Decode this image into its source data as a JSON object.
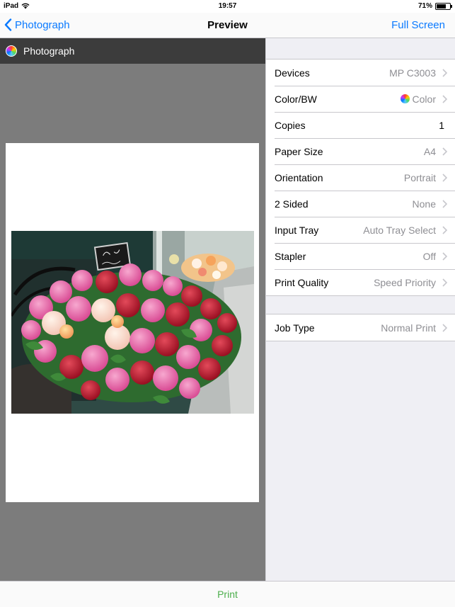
{
  "status": {
    "device": "iPad",
    "time": "19:57",
    "battery": "71%",
    "battery_level": 0.71
  },
  "nav": {
    "back_label": "Photograph",
    "title": "Preview",
    "right_label": "Full Screen"
  },
  "preview": {
    "header_label": "Photograph"
  },
  "settings": {
    "rows": [
      {
        "label": "Devices",
        "value": "MP C3003"
      },
      {
        "label": "Color/BW",
        "value": "Color"
      },
      {
        "label": "Copies",
        "value": "1"
      },
      {
        "label": "Paper Size",
        "value": "A4"
      },
      {
        "label": "Orientation",
        "value": "Portrait"
      },
      {
        "label": "2 Sided",
        "value": "None"
      },
      {
        "label": "Input Tray",
        "value": "Auto Tray Select"
      },
      {
        "label": "Stapler",
        "value": "Off"
      },
      {
        "label": "Print Quality",
        "value": "Speed Priority"
      }
    ],
    "job_row": {
      "label": "Job Type",
      "value": "Normal Print"
    }
  },
  "bottom": {
    "print_label": "Print"
  },
  "colors": {
    "accent": "#0a7aff",
    "print": "#4cae4c",
    "header_bg": "#3c3c3c",
    "preview_bg": "#7c7c7c"
  }
}
